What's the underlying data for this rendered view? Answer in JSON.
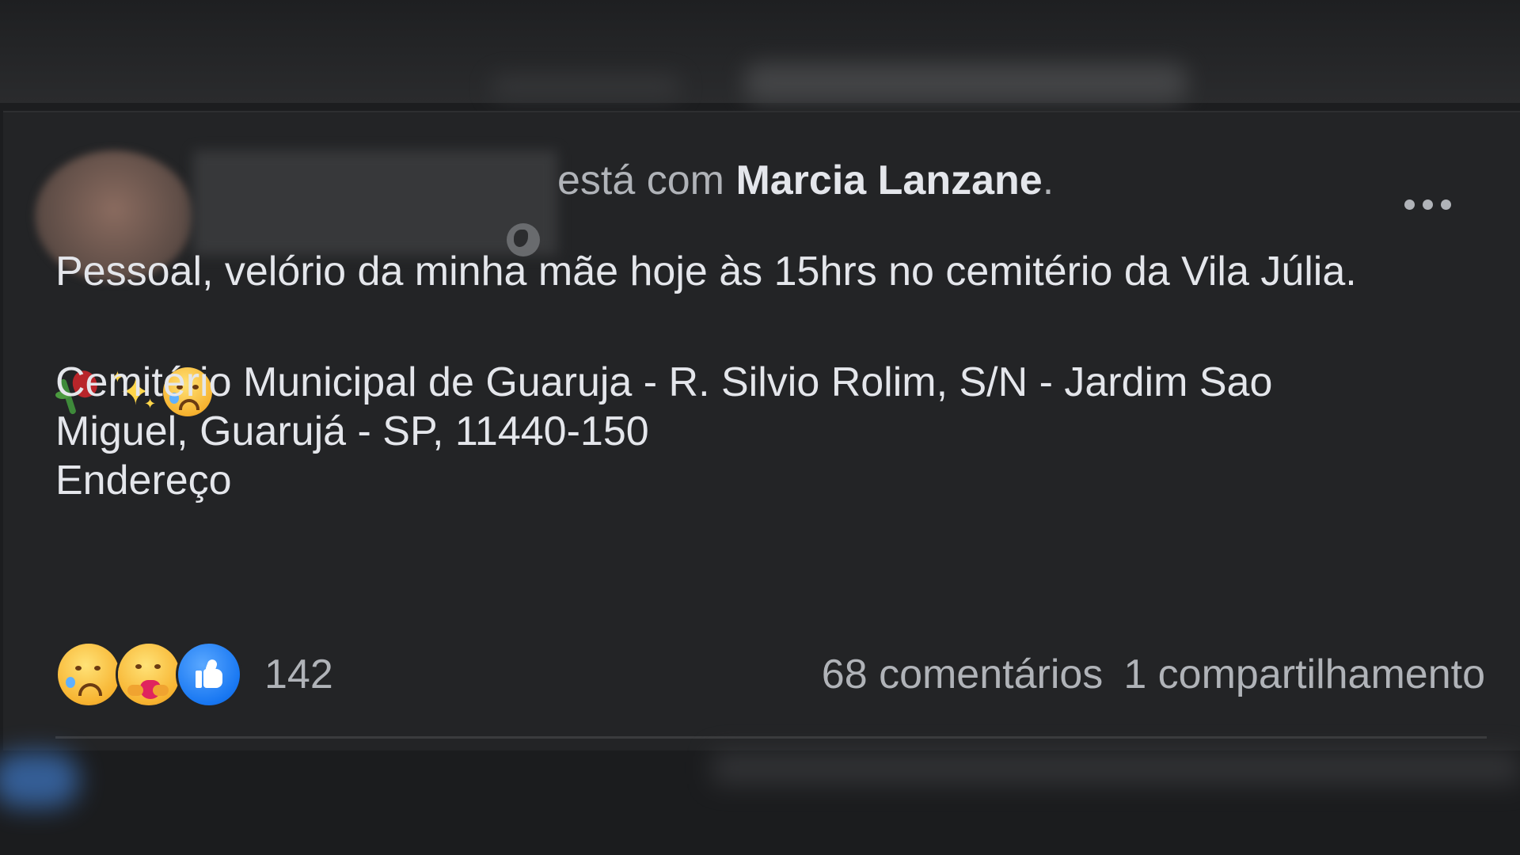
{
  "post": {
    "header": {
      "with_text": "está com",
      "tagged_name": "Marcia Lanzane",
      "trailing": "."
    },
    "body": {
      "line1": "Pessoal, velório da minha mãe hoje às 15hrs no cemitério da Vila Júlia.",
      "emojis": [
        "rose-icon",
        "sparkles-icon",
        "crying-face-icon"
      ],
      "address_line1": "Cemitério Municipal de Guaruja - R. Silvio Rolim, S/N - Jardim Sao",
      "address_line2": "Miguel, Guarujá - SP, 11440-150",
      "address_label": "Endereço"
    },
    "reactions": {
      "icons": [
        "sad-reaction-icon",
        "care-reaction-icon",
        "like-reaction-icon"
      ],
      "count": "142"
    },
    "comments": "68 comentários",
    "shares": "1 compartilhamento"
  },
  "colors": {
    "background": "#1c1d1f",
    "card": "#232426",
    "primary_text": "#e4e6eb",
    "secondary_text": "#b0b3b8",
    "like_blue": "#1877f2"
  }
}
